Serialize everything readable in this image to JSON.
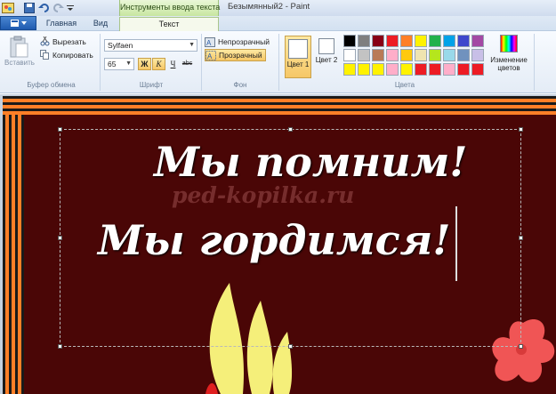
{
  "window": {
    "context_tab": "Инструменты ввода текста",
    "title": "Безымянный2 - Paint"
  },
  "tabs": {
    "home": "Главная",
    "view": "Вид",
    "text": "Текст"
  },
  "clipboard": {
    "paste": "Вставить",
    "cut": "Вырезать",
    "copy": "Копировать",
    "label": "Буфер обмена"
  },
  "font": {
    "family": "Sylfaen",
    "size": "65",
    "bold": "Ж",
    "italic": "К",
    "underline": "Ч",
    "strike": "abc",
    "label": "Шрифт"
  },
  "background": {
    "opaque": "Непрозрачный",
    "transparent": "Прозрачный",
    "label": "Фон"
  },
  "colors": {
    "color1_label": "Цвет 1",
    "color2_label": "Цвет 2",
    "color1": "#ffffff",
    "color2": "#ffffff",
    "edit_label": "Изменение цветов",
    "label": "Цвета",
    "palette_row1": [
      "#000000",
      "#7f7f7f",
      "#880015",
      "#ed1c24",
      "#ff7f27",
      "#fff200",
      "#22b14c",
      "#00a2e8",
      "#3f48cc",
      "#a349a4"
    ],
    "palette_row2": [
      "#ffffff",
      "#c3c3c3",
      "#b97a57",
      "#ffaec9",
      "#ffc90e",
      "#efe4b0",
      "#b5e61d",
      "#99d9ea",
      "#7092be",
      "#c8bfe7"
    ],
    "palette_row3": [
      "#fff200",
      "#fff200",
      "#fff200",
      "#ffaec9",
      "#fff200",
      "#ed1c24",
      "#ed1c24",
      "#ffaec9",
      "#ed1c24",
      "#ed1c24"
    ]
  },
  "canvas": {
    "line1": "Мы помним!",
    "line2": "Мы гордимся!",
    "watermark": "ped-kopilka.ru",
    "bg_color": "#4a0606"
  }
}
